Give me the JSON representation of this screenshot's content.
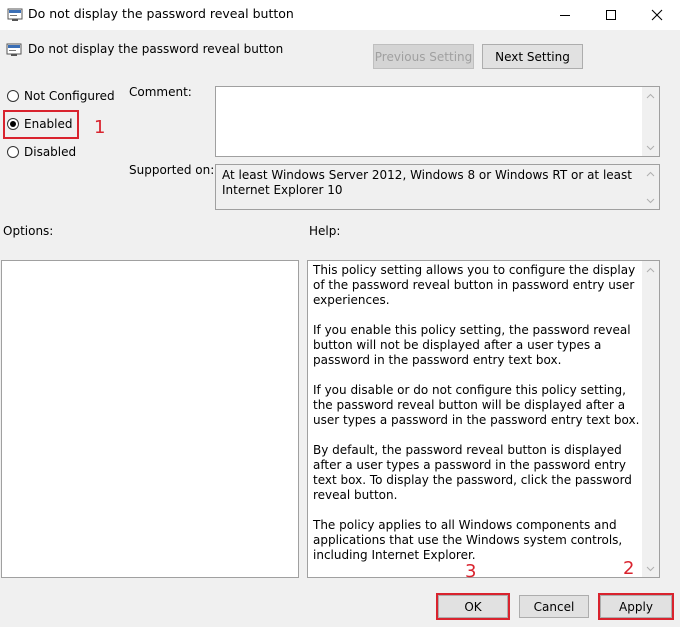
{
  "window": {
    "title": "Do not display the password reveal button",
    "controls": {
      "minimize": "minimize-icon",
      "maximize": "maximize-icon",
      "close": "close-icon"
    }
  },
  "header": {
    "policy_title": "Do not display the password reveal button",
    "previous_setting": "Previous Setting",
    "next_setting": "Next Setting"
  },
  "state": {
    "options": [
      "Not Configured",
      "Enabled",
      "Disabled"
    ],
    "selected": "Enabled"
  },
  "comment": {
    "label": "Comment:",
    "value": ""
  },
  "supported_on": {
    "label": "Supported on:",
    "value": "At least Windows Server 2012, Windows 8 or Windows RT or at least Internet Explorer 10"
  },
  "options_label": "Options:",
  "help_label": "Help:",
  "help_paragraphs": [
    "This policy setting allows you to configure the display of the password reveal button in password entry user experiences.",
    "If you enable this policy setting, the password reveal button will not be displayed after a user types a password in the password entry text box.",
    "If you disable or do not configure this policy setting, the password reveal button will be displayed after a user types a password in the password entry text box.",
    "By default, the password reveal button is displayed after a user types a password in the password entry text box. To display the password, click the password reveal button.",
    "The policy applies to all Windows components and applications that use the Windows system controls, including Internet Explorer."
  ],
  "footer": {
    "ok": "OK",
    "cancel": "Cancel",
    "apply": "Apply"
  },
  "annotations": {
    "step1": "1",
    "step2": "2",
    "step3": "3"
  },
  "colors": {
    "annotation_red": "#d9232e",
    "window_bg": "#f0f0f0"
  }
}
